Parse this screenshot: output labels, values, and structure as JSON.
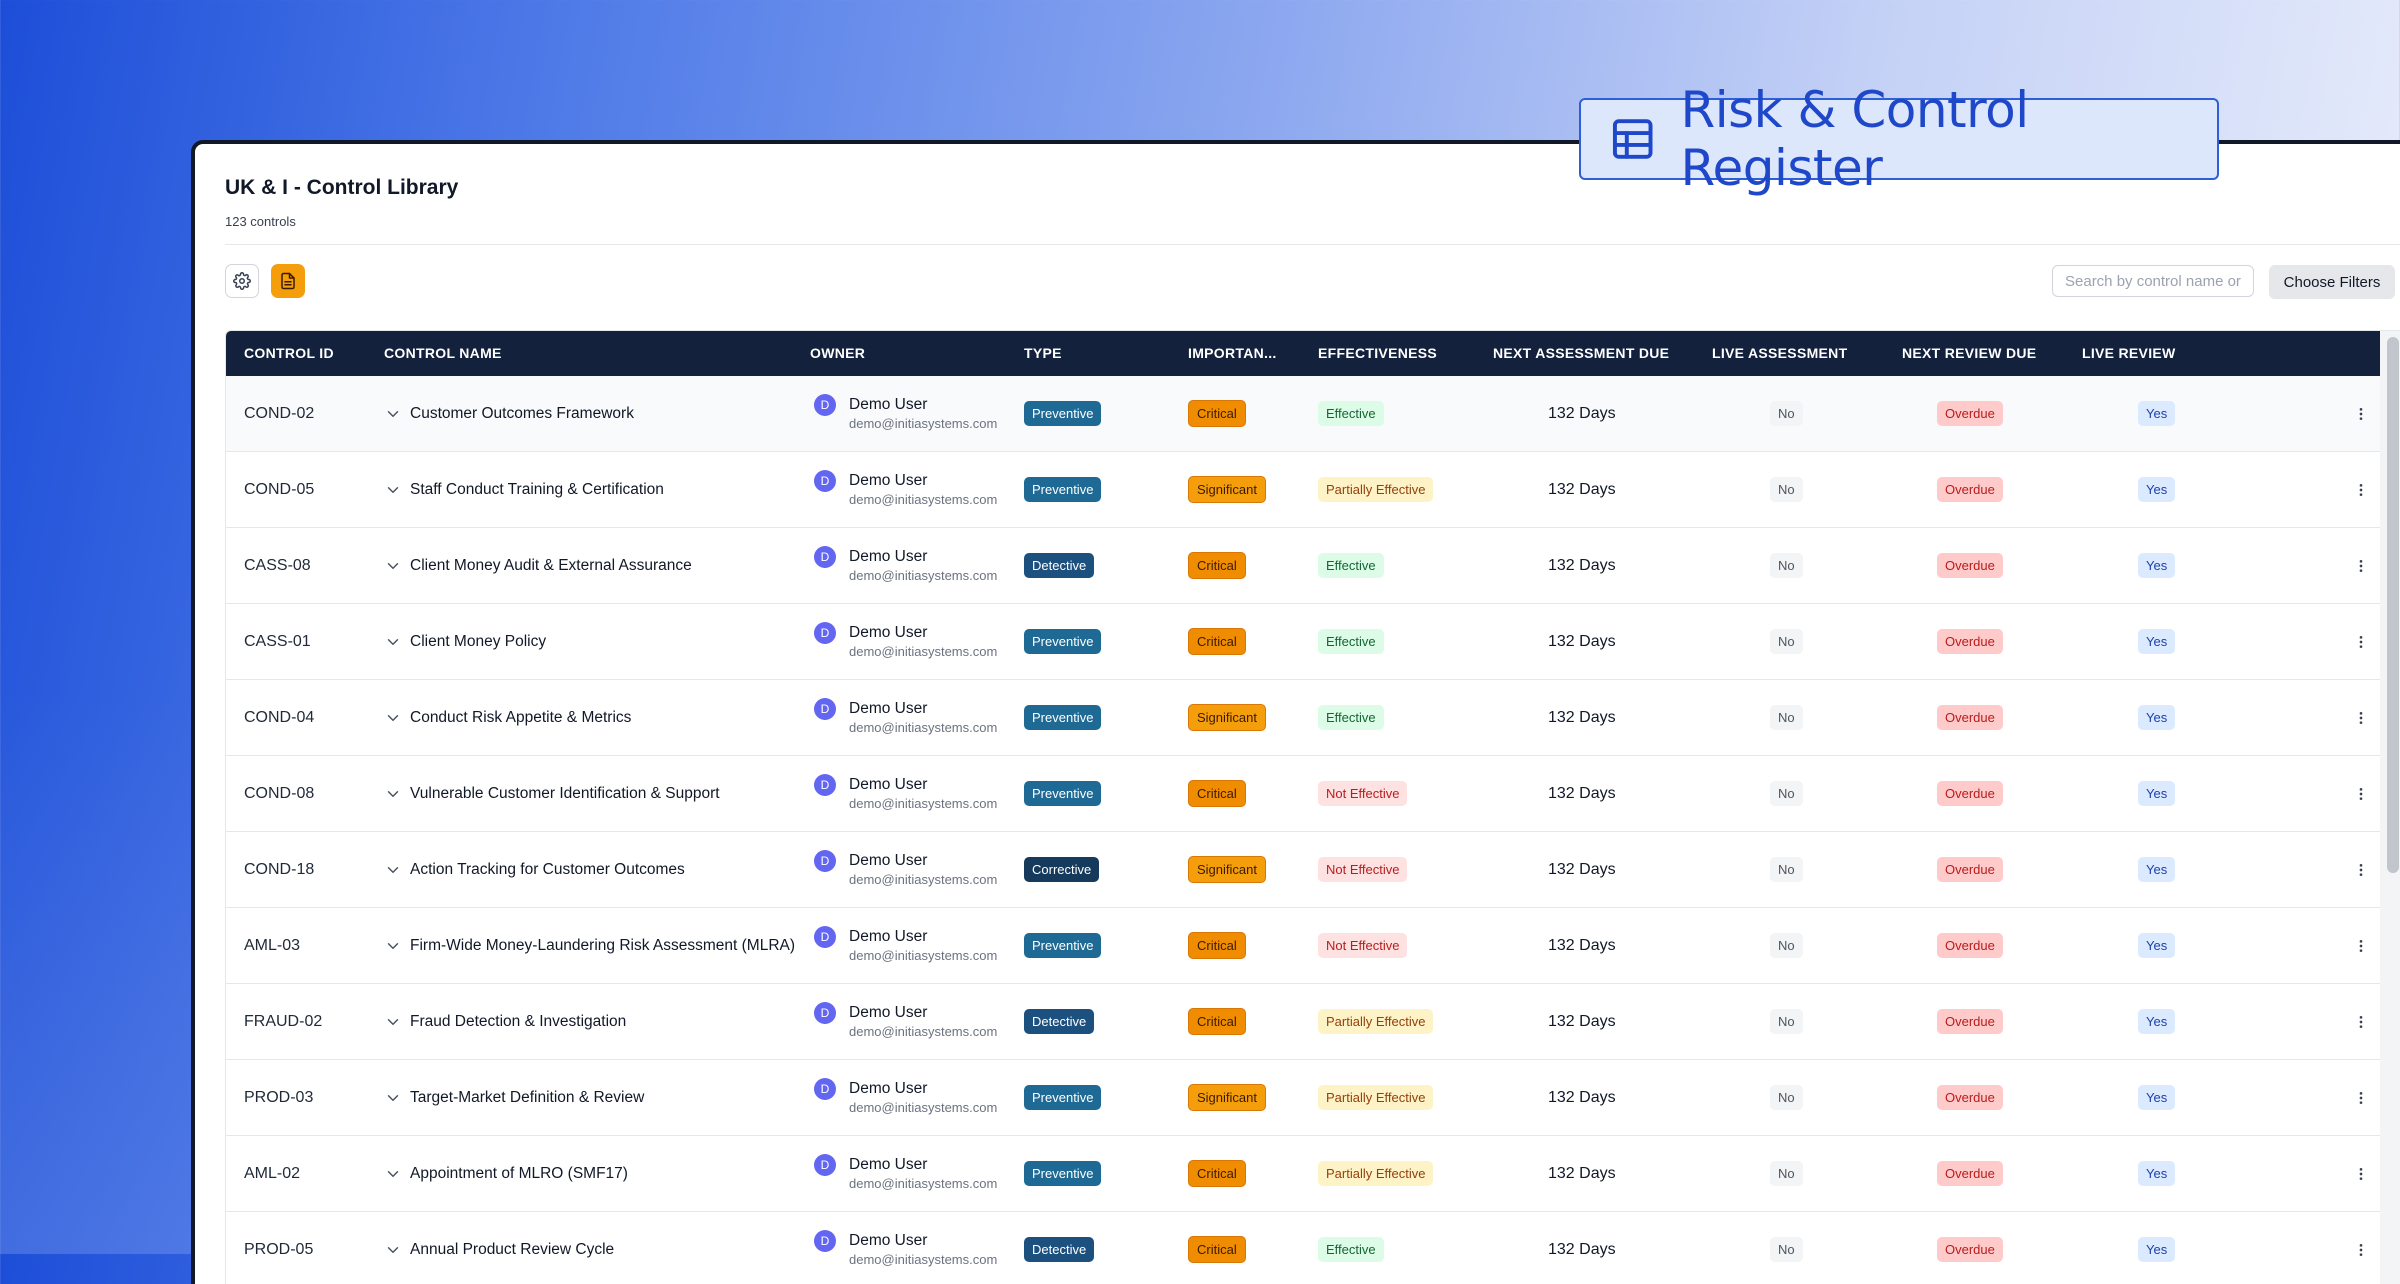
{
  "brand": {
    "title": "Risk & Control Register",
    "icon": "table-icon"
  },
  "page": {
    "title": "UK & I - Control Library",
    "subtitle": "123 controls"
  },
  "toolbar": {
    "settings_icon": "gear-icon",
    "report_icon": "document-icon",
    "search_placeholder": "Search by control name or ID",
    "filters_label": "Choose Filters"
  },
  "columns": {
    "id": "CONTROL ID",
    "name": "CONTROL NAME",
    "owner": "OWNER",
    "type": "TYPE",
    "importance": "IMPORTAN...",
    "effectiveness": "EFFECTIVENESS",
    "next_assessment": "NEXT ASSESSMENT DUE",
    "live_assessment": "LIVE ASSESSMENT",
    "next_review": "NEXT REVIEW DUE",
    "live_review": "LIVE REVIEW"
  },
  "colors": {
    "header_bg": "#13213c",
    "avatar": "#6366f1",
    "critical": "#f08c00",
    "significant": "#f59e0b",
    "accent": "#1e47c9"
  },
  "rows": [
    {
      "id": "COND-02",
      "name": "Customer Outcomes Framework",
      "avatar": "D",
      "owner": "Demo User",
      "email": "demo@initiasystems.com",
      "type": "Preventive",
      "importance": "Critical",
      "effectiveness": "Effective",
      "next_assessment": "132 Days",
      "live_assessment": "No",
      "next_review": "Overdue",
      "live_review": "Yes"
    },
    {
      "id": "COND-05",
      "name": "Staff Conduct Training & Certification",
      "avatar": "D",
      "owner": "Demo User",
      "email": "demo@initiasystems.com",
      "type": "Preventive",
      "importance": "Significant",
      "effectiveness": "Partially Effective",
      "next_assessment": "132 Days",
      "live_assessment": "No",
      "next_review": "Overdue",
      "live_review": "Yes"
    },
    {
      "id": "CASS-08",
      "name": "Client Money Audit & External Assurance",
      "avatar": "D",
      "owner": "Demo User",
      "email": "demo@initiasystems.com",
      "type": "Detective",
      "importance": "Critical",
      "effectiveness": "Effective",
      "next_assessment": "132 Days",
      "live_assessment": "No",
      "next_review": "Overdue",
      "live_review": "Yes"
    },
    {
      "id": "CASS-01",
      "name": "Client Money Policy",
      "avatar": "D",
      "owner": "Demo User",
      "email": "demo@initiasystems.com",
      "type": "Preventive",
      "importance": "Critical",
      "effectiveness": "Effective",
      "next_assessment": "132 Days",
      "live_assessment": "No",
      "next_review": "Overdue",
      "live_review": "Yes"
    },
    {
      "id": "COND-04",
      "name": "Conduct Risk Appetite & Metrics",
      "avatar": "D",
      "owner": "Demo User",
      "email": "demo@initiasystems.com",
      "type": "Preventive",
      "importance": "Significant",
      "effectiveness": "Effective",
      "next_assessment": "132 Days",
      "live_assessment": "No",
      "next_review": "Overdue",
      "live_review": "Yes"
    },
    {
      "id": "COND-08",
      "name": "Vulnerable Customer Identification & Support",
      "avatar": "D",
      "owner": "Demo User",
      "email": "demo@initiasystems.com",
      "type": "Preventive",
      "importance": "Critical",
      "effectiveness": "Not Effective",
      "next_assessment": "132 Days",
      "live_assessment": "No",
      "next_review": "Overdue",
      "live_review": "Yes"
    },
    {
      "id": "COND-18",
      "name": "Action Tracking for Customer Outcomes",
      "avatar": "D",
      "owner": "Demo User",
      "email": "demo@initiasystems.com",
      "type": "Corrective",
      "importance": "Significant",
      "effectiveness": "Not Effective",
      "next_assessment": "132 Days",
      "live_assessment": "No",
      "next_review": "Overdue",
      "live_review": "Yes"
    },
    {
      "id": "AML-03",
      "name": "Firm-Wide Money-Laundering Risk Assessment (MLRA)",
      "avatar": "D",
      "owner": "Demo User",
      "email": "demo@initiasystems.com",
      "type": "Preventive",
      "importance": "Critical",
      "effectiveness": "Not Effective",
      "next_assessment": "132 Days",
      "live_assessment": "No",
      "next_review": "Overdue",
      "live_review": "Yes"
    },
    {
      "id": "FRAUD-02",
      "name": "Fraud Detection & Investigation",
      "avatar": "D",
      "owner": "Demo User",
      "email": "demo@initiasystems.com",
      "type": "Detective",
      "importance": "Critical",
      "effectiveness": "Partially Effective",
      "next_assessment": "132 Days",
      "live_assessment": "No",
      "next_review": "Overdue",
      "live_review": "Yes"
    },
    {
      "id": "PROD-03",
      "name": "Target-Market Definition & Review",
      "avatar": "D",
      "owner": "Demo User",
      "email": "demo@initiasystems.com",
      "type": "Preventive",
      "importance": "Significant",
      "effectiveness": "Partially Effective",
      "next_assessment": "132 Days",
      "live_assessment": "No",
      "next_review": "Overdue",
      "live_review": "Yes"
    },
    {
      "id": "AML-02",
      "name": "Appointment of MLRO (SMF17)",
      "avatar": "D",
      "owner": "Demo User",
      "email": "demo@initiasystems.com",
      "type": "Preventive",
      "importance": "Critical",
      "effectiveness": "Partially Effective",
      "next_assessment": "132 Days",
      "live_assessment": "No",
      "next_review": "Overdue",
      "live_review": "Yes"
    },
    {
      "id": "PROD-05",
      "name": "Annual Product Review Cycle",
      "avatar": "D",
      "owner": "Demo User",
      "email": "demo@initiasystems.com",
      "type": "Detective",
      "importance": "Critical",
      "effectiveness": "Effective",
      "next_assessment": "132 Days",
      "live_assessment": "No",
      "next_review": "Overdue",
      "live_review": "Yes"
    }
  ]
}
